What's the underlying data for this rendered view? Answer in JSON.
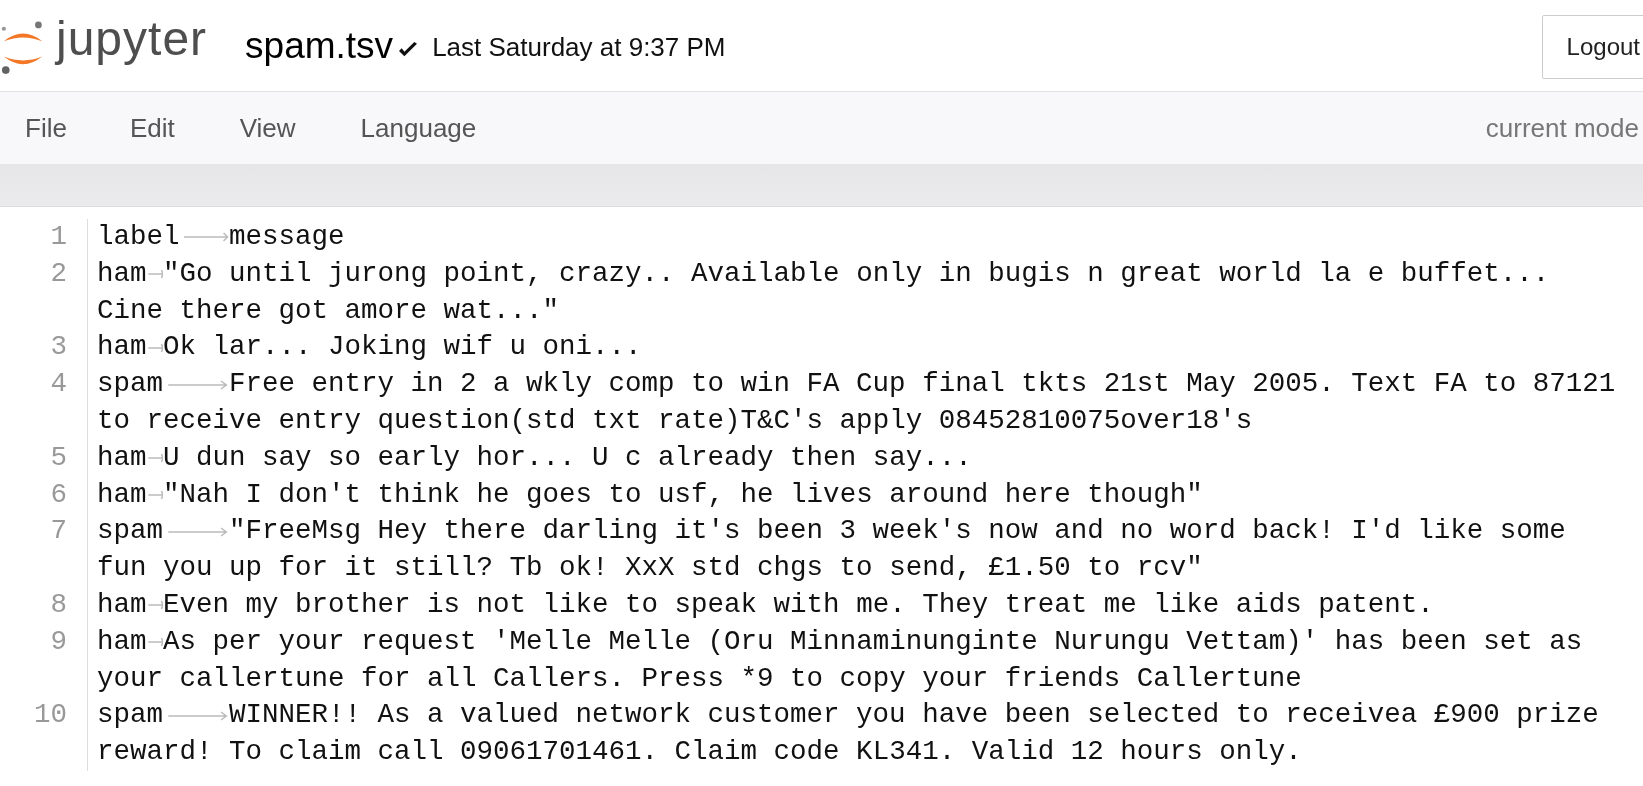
{
  "header": {
    "logo_text": "jupyter",
    "file_name": "spam.tsv",
    "saved_time": "Last Saturday at 9:37 PM",
    "logout": "Logout"
  },
  "menu": {
    "items": [
      "File",
      "Edit",
      "View",
      "Language"
    ],
    "mode": "current mode"
  },
  "editor": {
    "lines": [
      {
        "number": "1",
        "label": "label",
        "rows": [
          "message"
        ]
      },
      {
        "number": "2",
        "label": "ham",
        "rows": [
          "\"Go until jurong point, crazy.. Available only in bugis n great world la e buffet...",
          "Cine there got amore wat...\""
        ]
      },
      {
        "number": "3",
        "label": "ham",
        "rows": [
          "Ok lar... Joking wif u oni..."
        ]
      },
      {
        "number": "4",
        "label": "spam",
        "rows": [
          "Free entry in 2 a wkly comp to win FA Cup final tkts 21st May 2005. Text FA to 87121",
          "to receive entry question(std txt rate)T&C's apply 08452810075over18's"
        ]
      },
      {
        "number": "5",
        "label": "ham",
        "rows": [
          "U dun say so early hor... U c already then say..."
        ]
      },
      {
        "number": "6",
        "label": "ham",
        "rows": [
          "\"Nah I don't think he goes to usf, he lives around here though\""
        ]
      },
      {
        "number": "7",
        "label": "spam",
        "rows": [
          "\"FreeMsg Hey there darling it's been 3 week's now and no word back! I'd like some",
          "fun you up for it still? Tb ok! XxX std chgs to send, £1.50 to rcv\""
        ]
      },
      {
        "number": "8",
        "label": "ham",
        "rows": [
          "Even my brother is not like to speak with me. They treat me like aids patent."
        ]
      },
      {
        "number": "9",
        "label": "ham",
        "rows": [
          "As per your request 'Melle Melle (Oru Minnaminunginte Nurungu Vettam)' has been set as",
          "your callertune for all Callers. Press *9 to copy your friends Callertune"
        ]
      },
      {
        "number": "10",
        "label": "spam",
        "rows": [
          "WINNER!! As a valued network customer you have been selected to receivea £900 prize",
          "reward! To claim call 09061701461. Claim code KL341. Valid 12 hours only."
        ]
      }
    ]
  }
}
